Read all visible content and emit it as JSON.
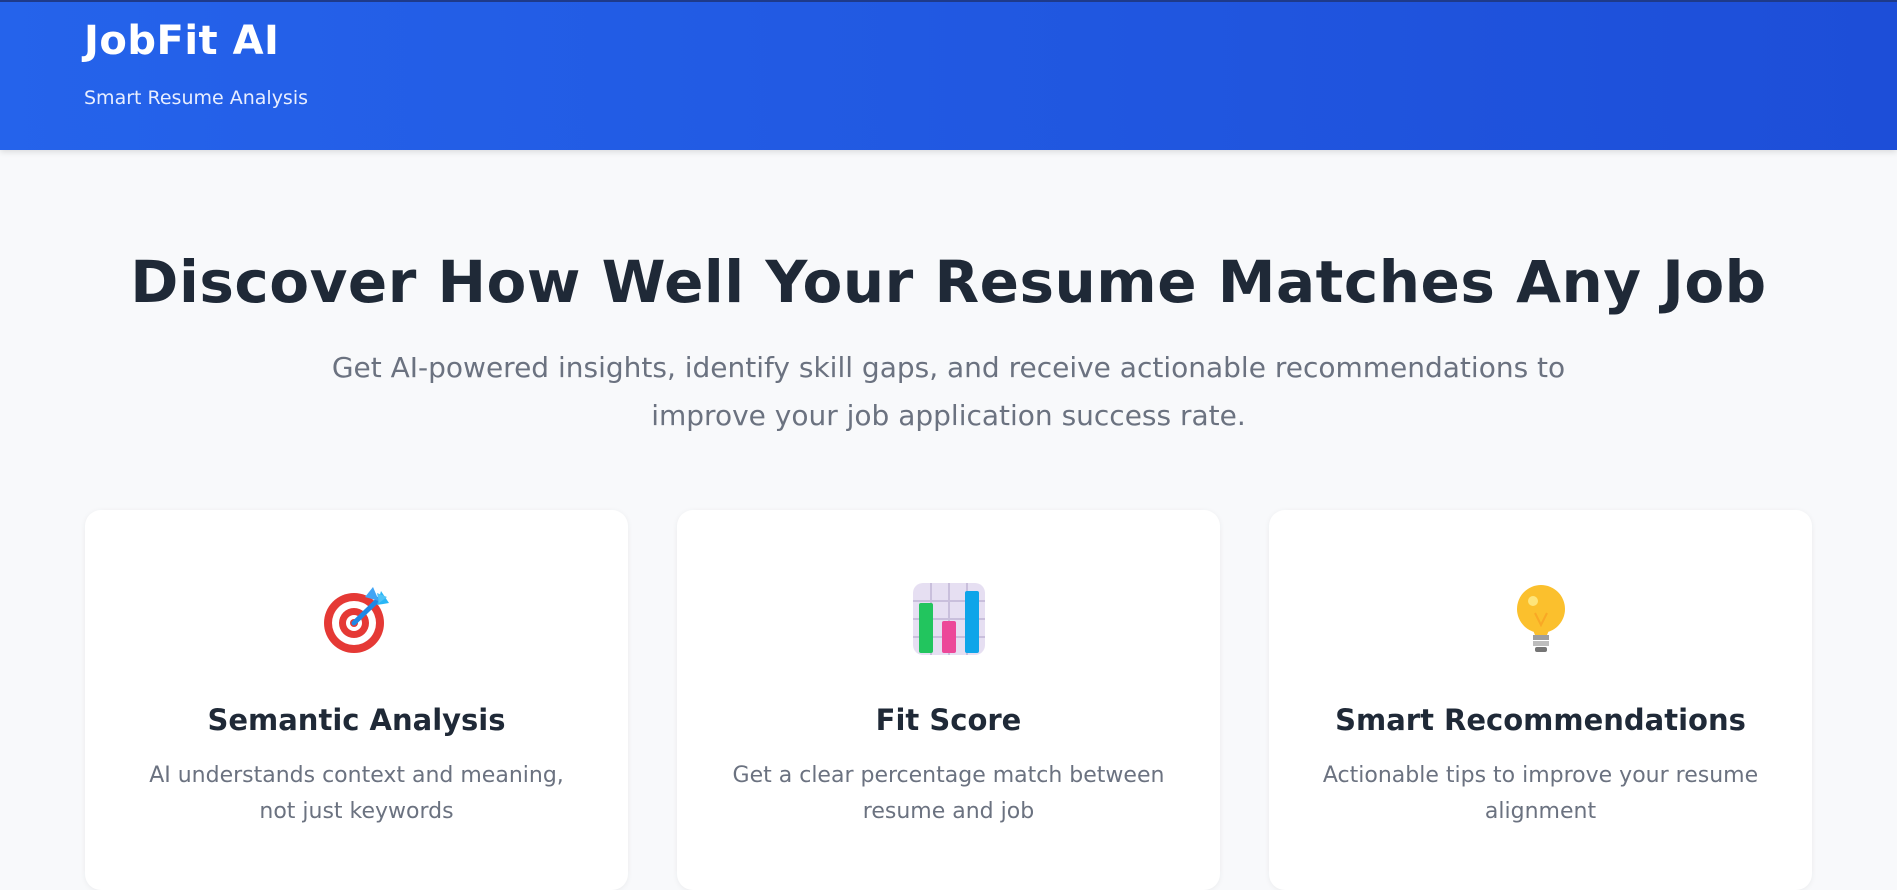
{
  "header": {
    "title": "JobFit AI",
    "subtitle": "Smart Resume Analysis",
    "colors": {
      "gradient_start": "#2563eb",
      "gradient_end": "#1d4ed8"
    }
  },
  "hero": {
    "title": "Discover How Well Your Resume Matches Any Job",
    "subtitle": "Get AI-powered insights, identify skill gaps, and receive actionable recommendations to improve your job application success rate."
  },
  "features": [
    {
      "icon": "target-icon",
      "title": "Semantic Analysis",
      "description": "AI understands context and meaning, not just keywords"
    },
    {
      "icon": "bar-chart-icon",
      "title": "Fit Score",
      "description": "Get a clear percentage match between resume and job"
    },
    {
      "icon": "lightbulb-icon",
      "title": "Smart Recommendations",
      "description": "Actionable tips to improve your resume alignment"
    }
  ]
}
